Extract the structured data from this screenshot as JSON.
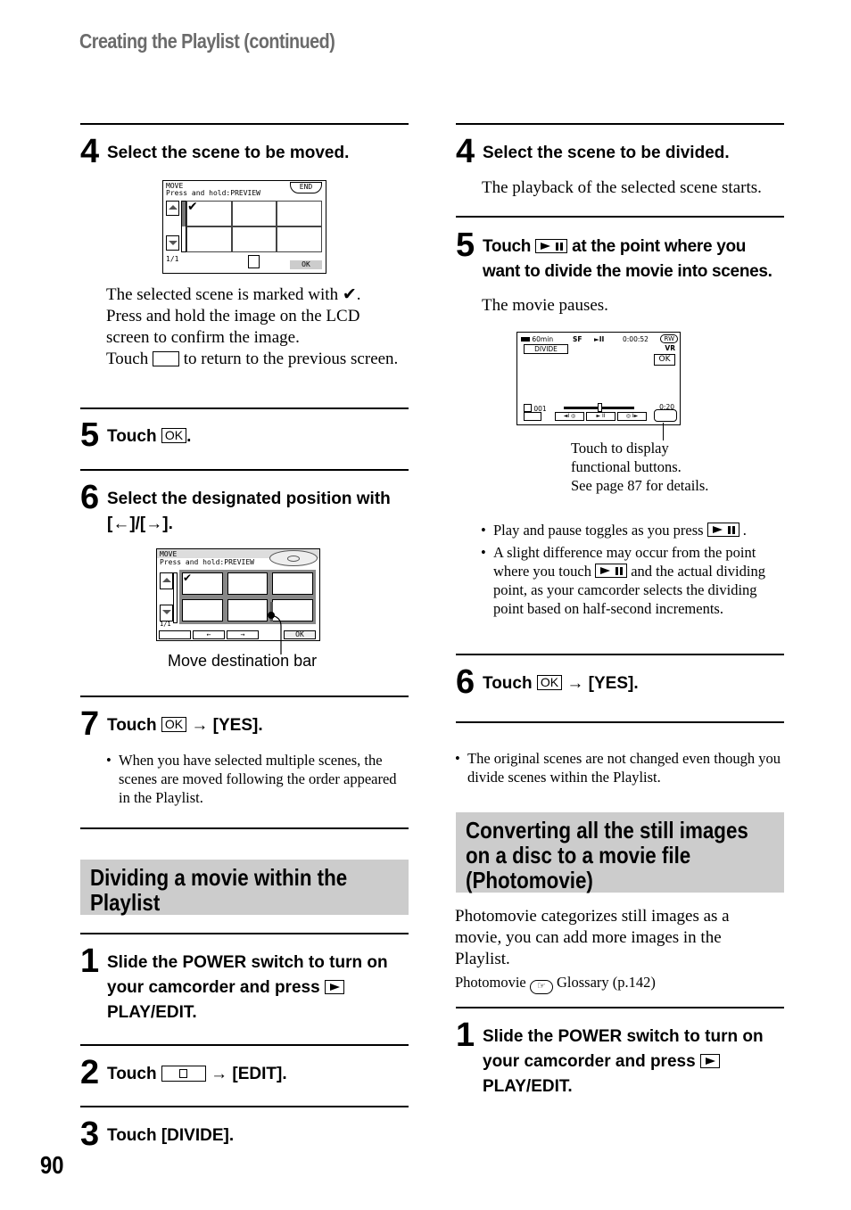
{
  "running_head": "Creating the Playlist (continued)",
  "page_number": "90",
  "left_column": {
    "move_steps": [
      {
        "num": "4",
        "text": "Select the scene to be moved."
      },
      {
        "num": "5",
        "text_before": "Touch",
        "button": "OK",
        "text_after": "."
      },
      {
        "num": "6",
        "text": "Select the designated position with [←]/[→]."
      },
      {
        "num": "7",
        "text_before": "Touch",
        "button": "OK",
        "text_after": "→ [YES]."
      }
    ],
    "step4_body": {
      "line1": "The selected scene is marked with ✔.",
      "line2": "Press and hold the image on the LCD screen to confirm the image.",
      "touch": "Touch",
      "line3": "to return to the previous screen."
    },
    "lcd_move1": {
      "title": "MOVE",
      "subtitle": "Press and hold:PREVIEW",
      "end_button": "END",
      "page": "1/1",
      "ok_button": "OK"
    },
    "lcd_move2": {
      "title": "MOVE",
      "subtitle": "Press and hold:PREVIEW",
      "page": "1/1",
      "ok_button": "OK",
      "left_arrow": "←",
      "right_arrow": "→",
      "caption": "Move destination bar"
    },
    "step7_note": "When you have selected multiple scenes, the scenes are moved following the order appeared in the Playlist.",
    "section_title": "Dividing a movie within the Playlist",
    "divide_steps": [
      {
        "num": "1",
        "text_before": "Slide the POWER switch to turn on your camcorder and press",
        "text_after": "PLAY/EDIT."
      },
      {
        "num": "2",
        "text_before": "Touch",
        "text_after": "→ [EDIT]."
      },
      {
        "num": "3",
        "text": "Touch [DIVIDE]."
      }
    ]
  },
  "right_column": {
    "steps": [
      {
        "num": "4",
        "text": "Select the scene to be divided.",
        "body": "The playback of the selected scene starts."
      },
      {
        "num": "5",
        "text_before": "Touch",
        "text_after": "at the point where you want to divide the movie into scenes.",
        "body": "The movie pauses."
      },
      {
        "num": "6",
        "text_before": "Touch",
        "button": "OK",
        "text_after": "→ [YES]."
      }
    ],
    "lcd_divide": {
      "battery": "60min",
      "time": "0:00:52",
      "disc": "RW",
      "format": "VR",
      "title": "DIVIDE",
      "ok_button": "OK",
      "scene": "001",
      "remaining": "0:20",
      "callout": [
        "Touch to display",
        "functional buttons.",
        "See page 87 for details."
      ]
    },
    "notes": [
      {
        "before": "Play and pause toggles as you press",
        "after": "."
      },
      {
        "before": "A slight difference may occur from the point where you touch",
        "after": "and the actual dividing point, as your camcorder selects the dividing point based on half-second increments."
      }
    ],
    "note_original": "The original scenes are not changed even though you divide scenes within the Playlist.",
    "section_title": "Converting all the still images on a disc to a movie file (Photomovie)",
    "section_body": "Photomovie categorizes still images as a movie, you can add more images in the Playlist.",
    "glossary_term": "Photomovie",
    "glossary_ref": "Glossary (p.142)",
    "step1": {
      "num": "1",
      "text_before": "Slide the POWER switch to turn on your camcorder and press",
      "text_after": "PLAY/EDIT."
    }
  }
}
